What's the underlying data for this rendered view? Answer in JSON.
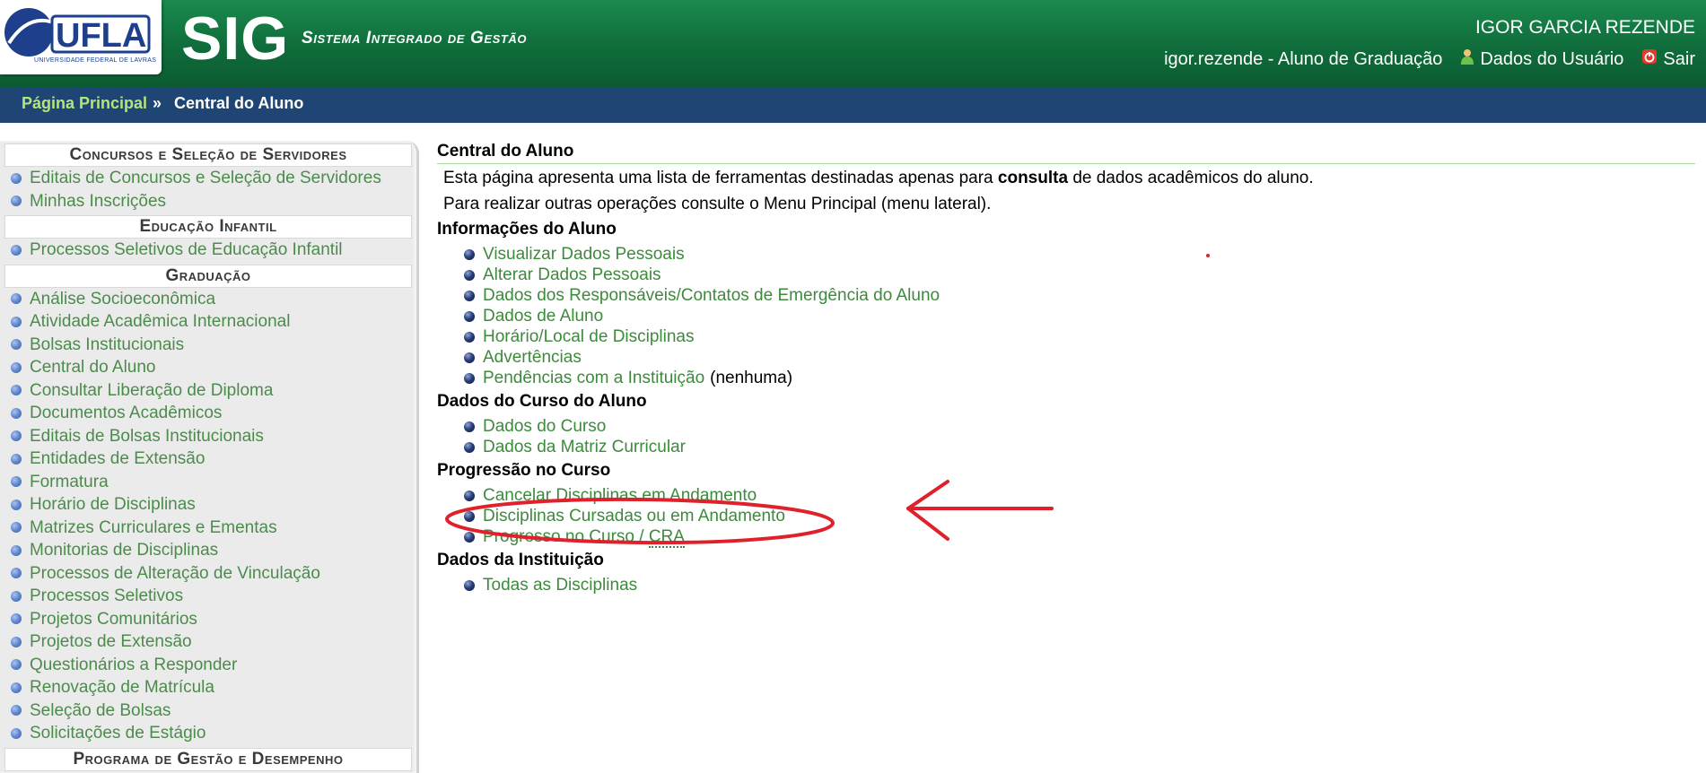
{
  "header": {
    "logo_text": "UFLA",
    "logo_subtitle": "UNIVERSIDADE FEDERAL DE LAVRAS",
    "app_title": "SIG",
    "app_subtitle": "Sistema Integrado de Gestão",
    "user_full_name": "IGOR GARCIA REZENDE",
    "user_login": "igor.rezende - Aluno de Graduação",
    "user_data_link": "Dados do Usuário",
    "logout_link": "Sair",
    "colors": {
      "header_green": "#0f6b3a",
      "breadcrumb_blue": "#1f4574",
      "link_green": "#3d8a3d"
    }
  },
  "breadcrumb": {
    "home": "Página Principal",
    "separator": "»",
    "current": "Central do Aluno"
  },
  "sidebar": {
    "sections": [
      {
        "title": "Concursos e Seleção de Servidores",
        "items": [
          "Editais de Concursos e Seleção de Servidores",
          "Minhas Inscrições"
        ]
      },
      {
        "title": "Educação Infantil",
        "items": [
          "Processos Seletivos de Educação Infantil"
        ]
      },
      {
        "title": "Graduação",
        "items": [
          "Análise Socioeconômica",
          "Atividade Acadêmica Internacional",
          "Bolsas Institucionais",
          "Central do Aluno",
          "Consultar Liberação de Diploma",
          "Documentos Acadêmicos",
          "Editais de Bolsas Institucionais",
          "Entidades de Extensão",
          "Formatura",
          "Horário de Disciplinas",
          "Matrizes Curriculares e Ementas",
          "Monitorias de Disciplinas",
          "Processos de Alteração de Vinculação",
          "Processos Seletivos",
          "Projetos Comunitários",
          "Projetos de Extensão",
          "Questionários a Responder",
          "Renovação de Matrícula",
          "Seleção de Bolsas",
          "Solicitações de Estágio"
        ]
      },
      {
        "title": "Programa de Gestão e Desempenho",
        "items": []
      }
    ]
  },
  "main": {
    "title": "Central do Aluno",
    "intro_pre": "Esta página apresenta uma lista de ferramentas destinadas apenas para",
    "intro_bold": "consulta",
    "intro_post": "de dados acadêmicos do aluno.",
    "intro_line2": "Para realizar outras operações consulte o Menu Principal (menu lateral).",
    "groups": [
      {
        "title": "Informações do Aluno",
        "links": [
          "Visualizar Dados Pessoais",
          "Alterar Dados Pessoais",
          "Dados dos Responsáveis/Contatos de Emergência do Aluno",
          "Dados de Aluno",
          "Horário/Local de Disciplinas",
          "Advertências",
          "Pendências com a Instituição"
        ],
        "pendencias_note": "(nenhuma)"
      },
      {
        "title": "Dados do Curso do Aluno",
        "links": [
          "Dados do Curso",
          "Dados da Matriz Curricular"
        ]
      },
      {
        "title": "Progressão no Curso",
        "links": [
          "Cancelar Disciplinas em Andamento",
          "Disciplinas Cursadas ou em Andamento"
        ],
        "progress_link_pre": "Progresso no Curso / ",
        "progress_link_abbr": "CRA"
      },
      {
        "title": "Dados da Instituição",
        "links": [
          "Todas as Disciplinas"
        ]
      }
    ]
  },
  "annotation": {
    "color": "#e0202a",
    "shapes": [
      "ellipse-around-link",
      "left-pointing-arrow"
    ]
  }
}
